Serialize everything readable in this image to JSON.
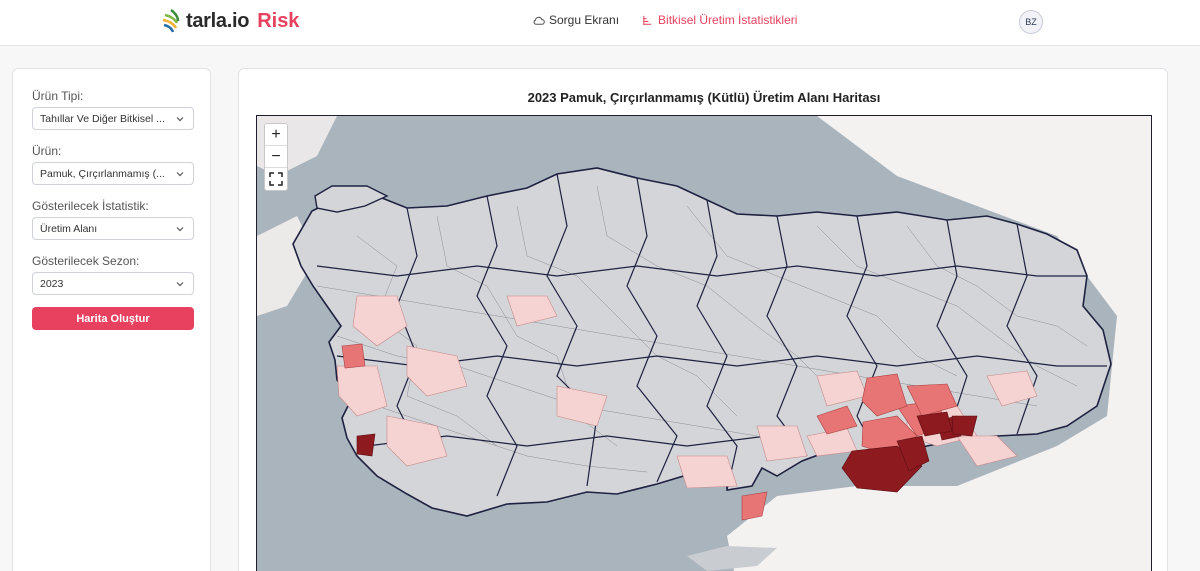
{
  "header": {
    "logo_text": "tarla.io",
    "logo_accent": "Risk",
    "nav": [
      {
        "label": "Sorgu Ekranı",
        "icon": "cloud-icon",
        "active": false
      },
      {
        "label": "Bitkisel Üretim İstatistikleri",
        "icon": "sprout-icon",
        "active": true
      }
    ],
    "avatar": "BZ"
  },
  "sidebar": {
    "fields": [
      {
        "label": "Ürün Tipi:",
        "value": "Tahıllar Ve Diğer Bitkisel ..."
      },
      {
        "label": "Ürün:",
        "value": "Pamuk, Çırçırlanmamış (..."
      },
      {
        "label": "Gösterilecek İstatistik:",
        "value": "Üretim Alanı"
      },
      {
        "label": "Gösterilecek Sezon:",
        "value": "2023"
      }
    ],
    "button": "Harita Oluştur"
  },
  "main": {
    "title": "2023 Pamuk, Çırçırlanmamış (Kütlü) Üretim Alanı Haritası",
    "zoom_in": "+",
    "zoom_out": "−",
    "fullscreen_icon": "fullscreen-icon"
  },
  "colors": {
    "accent": "#e8415f",
    "map_sea": "#aab4bd",
    "map_land": "#d3d5d8",
    "high": "#8c1a1f",
    "medium": "#e26d6d",
    "low": "#f6c9c9"
  }
}
